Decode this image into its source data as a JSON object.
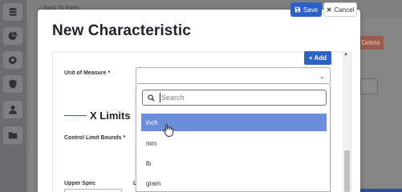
{
  "background": {
    "back_link": "« Back To Parts",
    "delete_label": "Delete"
  },
  "sidebar": {
    "items": [
      {
        "icon": "database-icon"
      },
      {
        "icon": "chart-pie-icon"
      },
      {
        "icon": "gear-icon"
      },
      {
        "icon": "shield-icon"
      },
      {
        "icon": "user-icon"
      },
      {
        "icon": "folder-icon"
      }
    ]
  },
  "modal": {
    "title": "New Characteristic",
    "save_label": "Save",
    "cancel_label": "Cancel",
    "add_label": "Add",
    "unit_of_measure_label": "Unit of Measure *",
    "x_limits_heading": "X Limits",
    "control_limit_bounds_label": "Control Limit Bounds *",
    "upper_spec_label": "Upper Spec",
    "lower_spec_label_partial": "L"
  },
  "dropdown": {
    "search_placeholder": "Search",
    "options": [
      "inch",
      "mm",
      "lb",
      "gram"
    ],
    "selected": "inch"
  },
  "colors": {
    "primary": "#2a62c6",
    "highlight": "#6b8edb"
  }
}
